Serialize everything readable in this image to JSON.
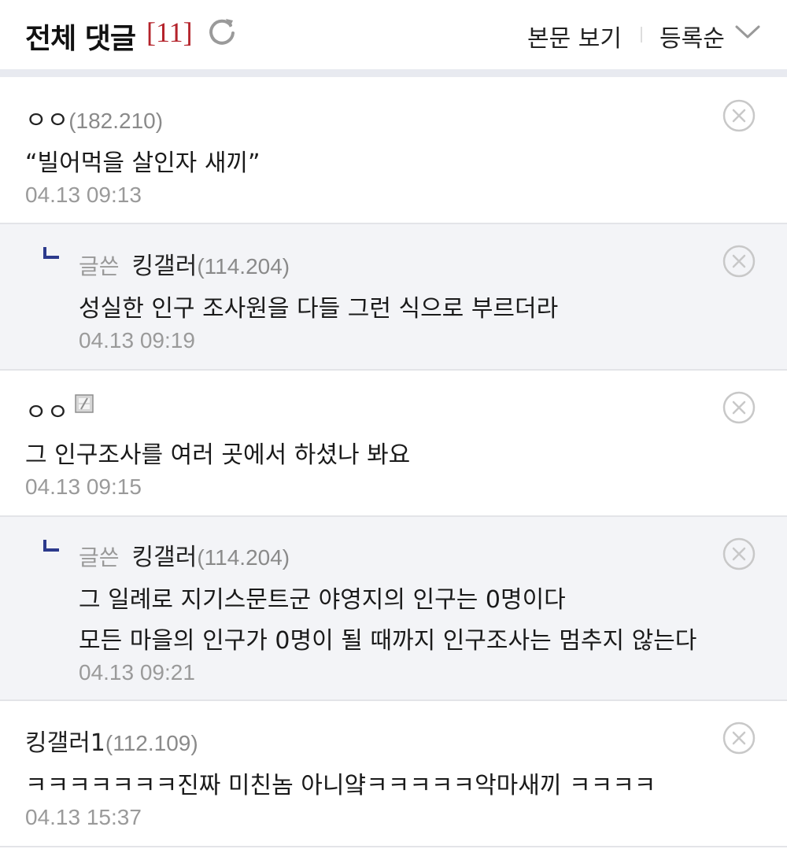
{
  "header": {
    "title": "전체 댓글",
    "count": "[11]",
    "view_label": "본문 보기",
    "sort_label": "등록순"
  },
  "comments": [
    {
      "nick": "ㅇㅇ",
      "ip": "(182.210)",
      "lines": [
        "“빌어먹을 살인자 새끼”"
      ],
      "date": "04.13 09:13"
    },
    {
      "tag": "글쓴",
      "nick": "킹갤러",
      "ip": "(114.204)",
      "lines": [
        "성실한 인구 조사원을 다들 그런 식으로 부르더라"
      ],
      "date": "04.13 09:19"
    },
    {
      "nick": "ㅇㅇ",
      "lines": [
        "그 인구조사를 여러 곳에서 하셨나 봐요"
      ],
      "date": "04.13 09:15"
    },
    {
      "tag": "글쓴",
      "nick": "킹갤러",
      "ip": "(114.204)",
      "lines": [
        "그 일례로 지기스문트군 야영지의 인구는 0명이다",
        "모든 마을의 인구가 0명이 될 때까지 인구조사는 멈추지 않는다"
      ],
      "date": "04.13 09:21"
    },
    {
      "nick": "킹갤러1",
      "ip": "(112.109)",
      "lines": [
        "ㅋㅋㅋㅋㅋㅋㅋ진짜 미친놈 아니얔ㅋㅋㅋㅋㅋ악마새끼 ㅋㅋㅋㅋ"
      ],
      "date": "04.13 15:37"
    }
  ],
  "colors": {
    "accent_red": "#b4232b",
    "reply_bg": "#f3f4f7",
    "reply_mark": "#2c3a8c"
  },
  "icons": [
    "refresh-icon",
    "chevron-down-icon",
    "delete-icon",
    "reply-arrow-icon",
    "gallery-user-icon"
  ]
}
